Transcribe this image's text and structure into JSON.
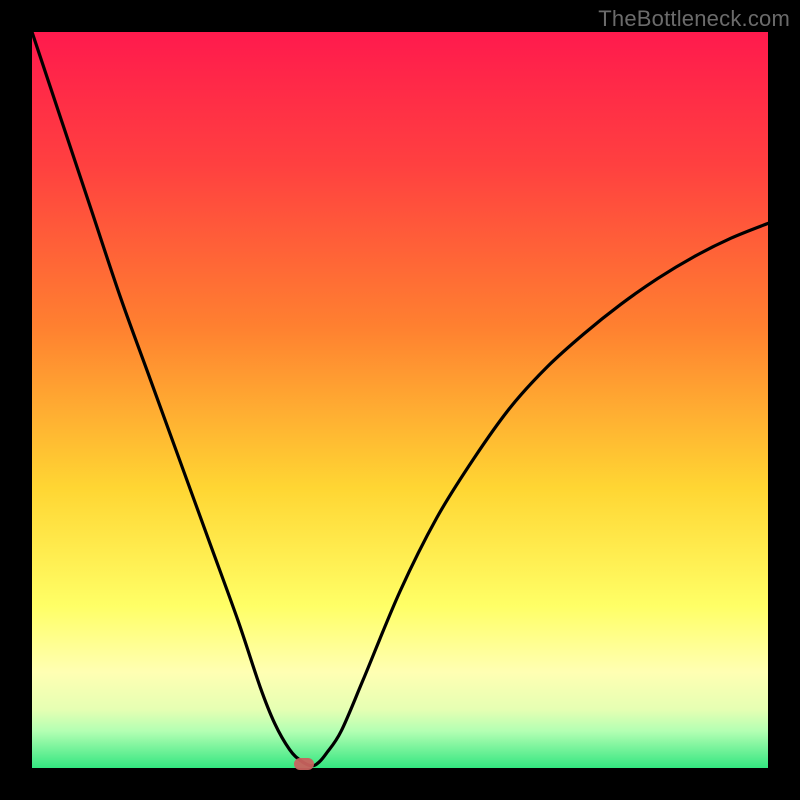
{
  "watermark": "TheBottleneck.com",
  "colors": {
    "frame": "#000000",
    "gradient_top": "#ff1a4d",
    "gradient_bottom": "#33e680",
    "curve": "#000000",
    "marker": "#c8625e"
  },
  "chart_data": {
    "type": "line",
    "title": "",
    "xlabel": "",
    "ylabel": "",
    "xlim": [
      0,
      100
    ],
    "ylim": [
      0,
      100
    ],
    "grid": false,
    "legend": false,
    "series": [
      {
        "name": "bottleneck-curve",
        "x": [
          0,
          4,
          8,
          12,
          16,
          20,
          24,
          28,
          31,
          33,
          35,
          36.5,
          38,
          39,
          40,
          42,
          45,
          50,
          55,
          60,
          65,
          70,
          75,
          80,
          85,
          90,
          95,
          100
        ],
        "y": [
          100,
          88,
          76,
          64,
          53,
          42,
          31,
          20,
          11,
          6,
          2.5,
          1,
          0.3,
          0.8,
          2,
          5,
          12,
          24,
          34,
          42,
          49,
          54.5,
          59,
          63,
          66.5,
          69.5,
          72,
          74
        ]
      }
    ],
    "annotations": [
      {
        "name": "minimum-marker",
        "x": 37,
        "y": 0.5
      }
    ]
  }
}
